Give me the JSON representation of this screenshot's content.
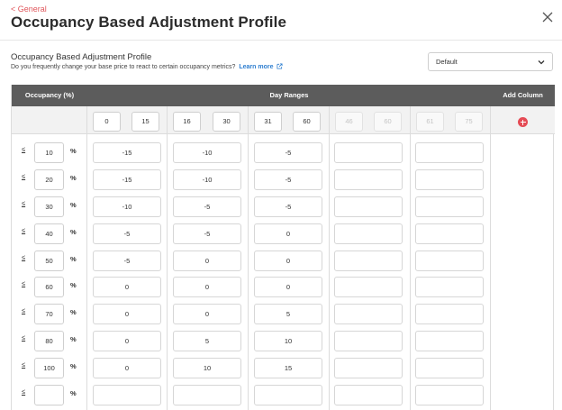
{
  "nav": {
    "back_label": "< General"
  },
  "page": {
    "title": "Occupancy Based Adjustment Profile"
  },
  "section": {
    "title": "Occupancy Based Adjustment Profile",
    "description": "Do you frequently change your base price to react to certain occupancy metrics?",
    "learn_more": "Learn more"
  },
  "profile_select": {
    "selected": "Default"
  },
  "table": {
    "headers": {
      "occupancy": "Occupancy (%)",
      "day_ranges": "Day Ranges",
      "add_column": "Add Column"
    },
    "ranges": [
      {
        "from": "0",
        "to": "15",
        "enabled": true
      },
      {
        "from": "16",
        "to": "30",
        "enabled": true
      },
      {
        "from": "31",
        "to": "60",
        "enabled": true
      },
      {
        "from": "46",
        "to": "60",
        "enabled": false
      },
      {
        "from": "61",
        "to": "75",
        "enabled": false
      }
    ],
    "le_symbol": "≤",
    "pct_symbol": "%",
    "rows": [
      {
        "occ": "10",
        "values": [
          "-15",
          "-10",
          "-5",
          "",
          ""
        ]
      },
      {
        "occ": "20",
        "values": [
          "-15",
          "-10",
          "-5",
          "",
          ""
        ]
      },
      {
        "occ": "30",
        "values": [
          "-10",
          "-5",
          "-5",
          "",
          ""
        ]
      },
      {
        "occ": "40",
        "values": [
          "-5",
          "-5",
          "0",
          "",
          ""
        ]
      },
      {
        "occ": "50",
        "values": [
          "-5",
          "0",
          "0",
          "",
          ""
        ]
      },
      {
        "occ": "60",
        "values": [
          "0",
          "0",
          "0",
          "",
          ""
        ]
      },
      {
        "occ": "70",
        "values": [
          "0",
          "0",
          "5",
          "",
          ""
        ]
      },
      {
        "occ": "80",
        "values": [
          "0",
          "5",
          "10",
          "",
          ""
        ]
      },
      {
        "occ": "100",
        "values": [
          "0",
          "10",
          "15",
          "",
          ""
        ]
      },
      {
        "occ": "",
        "values": [
          "",
          "",
          "",
          "",
          ""
        ]
      }
    ]
  },
  "colors": {
    "accent": "#e0565b",
    "header_bg": "#5c5c5c",
    "link": "#2f7fd0",
    "add_button": "#e54b55"
  }
}
